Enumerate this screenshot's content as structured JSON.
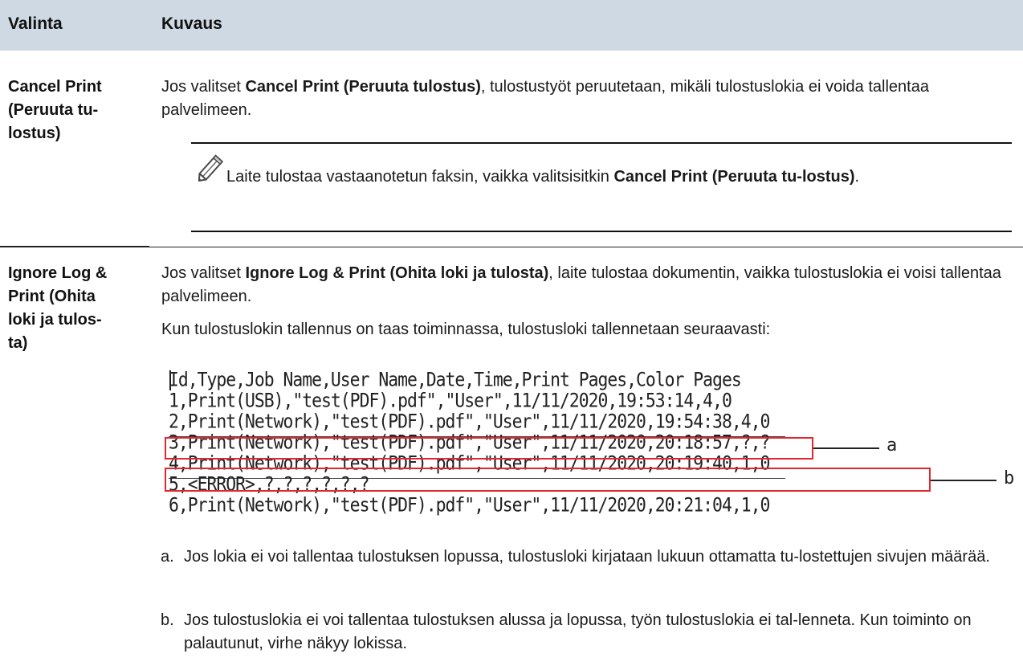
{
  "table": {
    "headers": [
      "Valinta",
      "Kuvaus"
    ],
    "rows": [
      {
        "option_lines": [
          "Cancel Print",
          "(Peruuta tu-",
          "lostus)"
        ],
        "desc": {
          "p1_pre": "Jos valitset ",
          "p1_bold": "Cancel Print (Peruuta tulostus)",
          "p1_post": ", tulostustyöt peruutetaan, mikäli tulostuslokia ei voida tallentaa palvelimeen.",
          "note_pre": "Laite tulostaa vastaanotetun faksin, vaikka valitsisitkin ",
          "note_bold": "Cancel Print (Peruuta tu-lostus)",
          "note_post": "."
        }
      },
      {
        "option_lines": [
          "Ignore Log &",
          "Print (Ohita",
          "loki ja tulos-",
          "ta)"
        ],
        "desc": {
          "p1_pre": "Jos valitset ",
          "p1_bold": "Ignore Log & Print (Ohita loki ja tulosta)",
          "p1_post": ", laite tulostaa dokumentin, vaikka tulostuslokia ei voisi tallentaa palvelimeen.",
          "p2": "Kun tulostuslokin tallennus on taas toiminnassa, tulostusloki tallennetaan seuraavasti:"
        }
      }
    ]
  },
  "icons": {
    "note": "pencil-icon"
  },
  "log": {
    "lines": [
      "Id,Type,Job Name,User Name,Date,Time,Print Pages,Color Pages",
      "1,Print(USB),\"test(PDF).pdf\",\"User\",11/11/2020,19:53:14,4,0",
      "2,Print(Network),\"test(PDF).pdf\",\"User\",11/11/2020,19:54:38,4,0",
      "3,Print(Network),\"test(PDF).pdf\",\"User\",11/11/2020,20:18:57,?,?",
      "4,Print(Network),\"test(PDF).pdf\",\"User\",11/11/2020,20:19:40,1,0",
      "5,<ERROR>,?,?,?,?,?,?",
      "6,Print(Network),\"test(PDF).pdf\",\"User\",11/11/2020,20:21:04,1,0"
    ],
    "callouts": [
      "a",
      "b"
    ]
  },
  "list": [
    {
      "marker": "a.",
      "text": "Jos lokia ei voi tallentaa tulostuksen lopussa, tulostusloki kirjataan lukuun ottamatta tu-lostettujen sivujen määrää."
    },
    {
      "marker": "b.",
      "text": "Jos tulostuslokia ei voi tallentaa tulostuksen alussa ja lopussa, työn tulostuslokia ei tal-lenneta. Kun toiminto on palautunut, virhe näkyy lokissa."
    }
  ],
  "colors": {
    "header_bg": "#cfd9e3",
    "highlight": "#e2262f"
  }
}
